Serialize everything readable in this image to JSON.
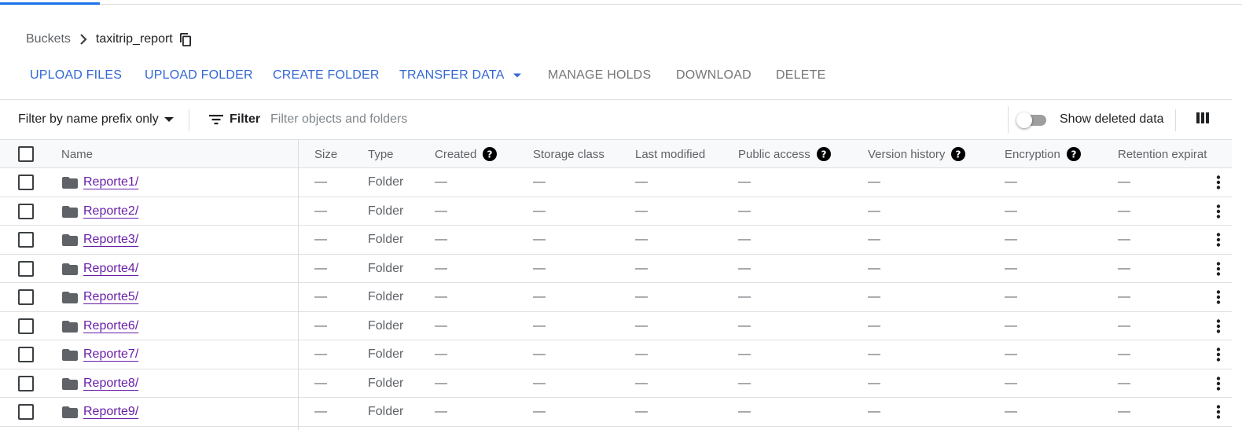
{
  "breadcrumb": {
    "root": "Buckets",
    "current": "taxitrip_report"
  },
  "toolbar": {
    "upload_files": "UPLOAD FILES",
    "upload_folder": "UPLOAD FOLDER",
    "create_folder": "CREATE FOLDER",
    "transfer_data": "TRANSFER DATA",
    "manage_holds": "MANAGE HOLDS",
    "download": "DOWNLOAD",
    "delete": "DELETE"
  },
  "filterbar": {
    "prefix_select": "Filter by name prefix only",
    "filter_label": "Filter",
    "placeholder": "Filter objects and folders",
    "show_deleted_label": "Show deleted data",
    "show_deleted_on": false
  },
  "columns": {
    "name": "Name",
    "size": "Size",
    "type": "Type",
    "created": "Created",
    "storage_class": "Storage class",
    "last_modified": "Last modified",
    "public_access": "Public access",
    "version_history": "Version history",
    "encryption": "Encryption",
    "retention": "Retention expirat"
  },
  "rows": [
    {
      "name": "Reporte1/",
      "size": "—",
      "type": "Folder",
      "created": "—",
      "storage_class": "—",
      "last_modified": "—",
      "public_access": "—",
      "version_history": "—",
      "encryption": "—",
      "retention": "—"
    },
    {
      "name": "Reporte2/",
      "size": "—",
      "type": "Folder",
      "created": "—",
      "storage_class": "—",
      "last_modified": "—",
      "public_access": "—",
      "version_history": "—",
      "encryption": "—",
      "retention": "—"
    },
    {
      "name": "Reporte3/",
      "size": "—",
      "type": "Folder",
      "created": "—",
      "storage_class": "—",
      "last_modified": "—",
      "public_access": "—",
      "version_history": "—",
      "encryption": "—",
      "retention": "—"
    },
    {
      "name": "Reporte4/",
      "size": "—",
      "type": "Folder",
      "created": "—",
      "storage_class": "—",
      "last_modified": "—",
      "public_access": "—",
      "version_history": "—",
      "encryption": "—",
      "retention": "—"
    },
    {
      "name": "Reporte5/",
      "size": "—",
      "type": "Folder",
      "created": "—",
      "storage_class": "—",
      "last_modified": "—",
      "public_access": "—",
      "version_history": "—",
      "encryption": "—",
      "retention": "—"
    },
    {
      "name": "Reporte6/",
      "size": "—",
      "type": "Folder",
      "created": "—",
      "storage_class": "—",
      "last_modified": "—",
      "public_access": "—",
      "version_history": "—",
      "encryption": "—",
      "retention": "—"
    },
    {
      "name": "Reporte7/",
      "size": "—",
      "type": "Folder",
      "created": "—",
      "storage_class": "—",
      "last_modified": "—",
      "public_access": "—",
      "version_history": "—",
      "encryption": "—",
      "retention": "—"
    },
    {
      "name": "Reporte8/",
      "size": "—",
      "type": "Folder",
      "created": "—",
      "storage_class": "—",
      "last_modified": "—",
      "public_access": "—",
      "version_history": "—",
      "encryption": "—",
      "retention": "—"
    },
    {
      "name": "Reporte9/",
      "size": "—",
      "type": "Folder",
      "created": "—",
      "storage_class": "—",
      "last_modified": "—",
      "public_access": "—",
      "version_history": "—",
      "encryption": "—",
      "retention": "—"
    }
  ],
  "colors": {
    "accent": "#3367d6",
    "link_visited": "#681da8",
    "disabled": "#757575"
  },
  "icons": {
    "breadcrumb_separator": "chevron-right-icon",
    "copy": "copy-icon",
    "dropdown": "arrow-drop-down-icon",
    "filter": "filter-list-icon",
    "columns": "view-column-icon",
    "help": "help-icon",
    "folder": "folder-icon",
    "row_menu": "more-vert-icon"
  }
}
